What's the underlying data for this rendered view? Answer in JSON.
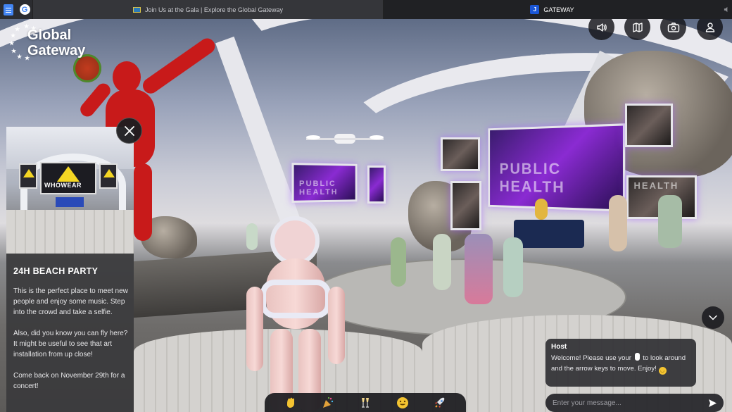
{
  "browser": {
    "inactive_tab_title": "Join Us at the Gala | Explore the Global Gateway",
    "active_tab_title": "GATEWAY",
    "active_tab_favicon": "J"
  },
  "logo": {
    "line1": "Global",
    "line2": "Gateway"
  },
  "top_controls": [
    {
      "icon": "speaker-icon"
    },
    {
      "icon": "map-icon"
    },
    {
      "icon": "camera-icon"
    },
    {
      "icon": "user-icon"
    }
  ],
  "info_panel": {
    "title": "24H BEACH PARTY",
    "paragraph1": "This is the perfect place to meet new people and enjoy some music. Step into the crowd and take a selfie.",
    "paragraph2": "Also, did you know you can fly here? It might be useful to see that art installation from up close!",
    "paragraph3": "Come back on November 29th for a concert!",
    "image_sign": "WHOWEAR"
  },
  "scene_text": {
    "screen_main": "PUBLIC HEALTH",
    "screen_small": "PUBLIC HEALTH",
    "screen_right": "HEALTH"
  },
  "chat": {
    "host_name": "Host",
    "host_message_part1": "Welcome! Please use your",
    "host_message_part2": "to look around and the arrow keys to move. Enjoy!",
    "input_placeholder": "Enter your message..."
  },
  "emoji_bar": [
    {
      "icon": "waving-hand-icon",
      "glyph": "👋"
    },
    {
      "icon": "party-popper-icon",
      "glyph": "🎉"
    },
    {
      "icon": "champagne-glasses-icon",
      "glyph": "🥂"
    },
    {
      "icon": "smiley-icon",
      "glyph": "😃"
    },
    {
      "icon": "rocket-icon",
      "glyph": "🚀"
    }
  ],
  "colors": {
    "panel_bg": "#3a3a3c",
    "statue_red": "#c81a1a",
    "screen_purple": "#8a2bd2"
  }
}
